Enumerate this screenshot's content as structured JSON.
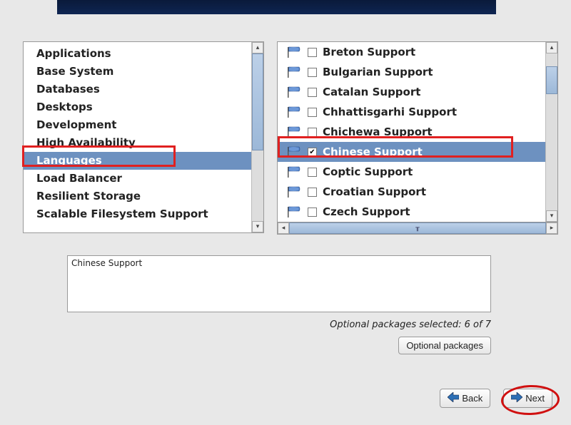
{
  "categories": [
    {
      "label": "Applications"
    },
    {
      "label": "Base System"
    },
    {
      "label": "Databases"
    },
    {
      "label": "Desktops"
    },
    {
      "label": "Development"
    },
    {
      "label": "High Availability"
    },
    {
      "label": "Languages"
    },
    {
      "label": "Load Balancer"
    },
    {
      "label": "Resilient Storage"
    },
    {
      "label": "Scalable Filesystem Support"
    }
  ],
  "categories_selected_index": 6,
  "packages": [
    {
      "label": "Breton Support",
      "checked": false
    },
    {
      "label": "Bulgarian Support",
      "checked": false
    },
    {
      "label": "Catalan Support",
      "checked": false
    },
    {
      "label": "Chhattisgarhi Support",
      "checked": false
    },
    {
      "label": "Chichewa Support",
      "checked": false
    },
    {
      "label": "Chinese Support",
      "checked": true
    },
    {
      "label": "Coptic Support",
      "checked": false
    },
    {
      "label": "Croatian Support",
      "checked": false
    },
    {
      "label": "Czech Support",
      "checked": false
    }
  ],
  "packages_selected_index": 5,
  "description": "Chinese Support",
  "status_text": "Optional packages selected: 6 of 7",
  "buttons": {
    "optional_packages": "Optional packages",
    "back": "Back",
    "next": "Next"
  }
}
